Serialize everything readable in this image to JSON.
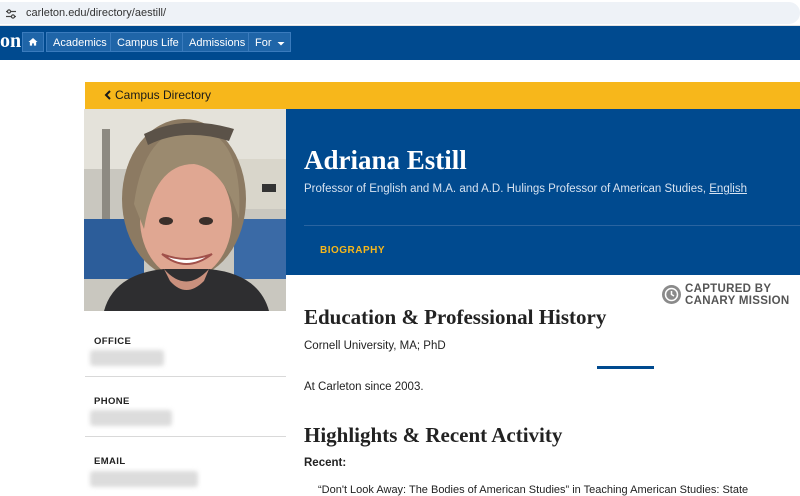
{
  "browser": {
    "url": "carleton.edu/directory/aestill/"
  },
  "nav": {
    "logo_fragment": "on",
    "items": [
      "Academics",
      "Campus Life",
      "Admissions",
      "For"
    ]
  },
  "breadcrumb": {
    "label": "Campus Directory"
  },
  "profile": {
    "name": "Adriana Estill",
    "role": "Professor of English and M.A. and A.D. Hulings Professor of American Studies,",
    "department": "English",
    "tab": "BIOGRAPHY"
  },
  "sidebar": {
    "office_label": "OFFICE",
    "phone_label": "PHONE",
    "email_label": "EMAIL"
  },
  "watermark": {
    "line1": "CAPTURED BY",
    "line2": "CANARY MISSION"
  },
  "content": {
    "education_heading": "Education & Professional History",
    "education_text": "Cornell University, MA; PhD",
    "since_text": "At Carleton since 2003.",
    "highlights_heading": "Highlights & Recent Activity",
    "recent_label": "Recent:",
    "cut_text": "“Don't Look Away: The Bodies of American Studies” in Teaching American Studies: State"
  },
  "colors": {
    "carleton_blue": "#004a8f",
    "maize": "#f7b71b"
  }
}
